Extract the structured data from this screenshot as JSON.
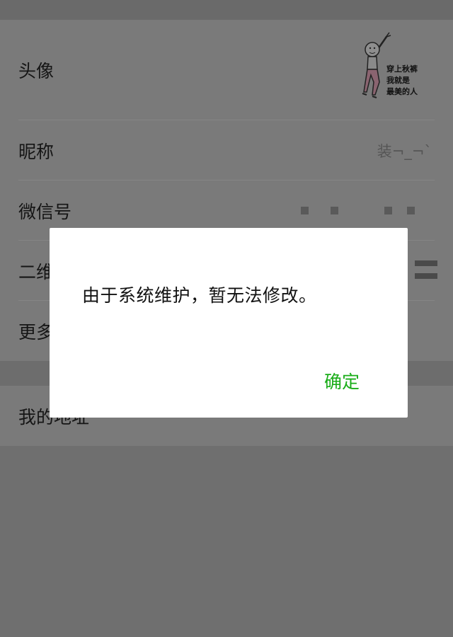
{
  "profile": {
    "avatar": {
      "label": "头像",
      "caption_lines": [
        "穿上秋裤",
        "我就是",
        "最美的人"
      ]
    },
    "nickname": {
      "label": "昵称",
      "value": "装¬_¬`"
    },
    "wechat_id": {
      "label": "微信号"
    },
    "qr_code": {
      "label": "二维码名片"
    },
    "more": {
      "label": "更多"
    },
    "address": {
      "label": "我的地址"
    }
  },
  "dialog": {
    "message": "由于系统维护，暂无法修改。",
    "ok_label": "确定"
  },
  "colors": {
    "accent_green": "#1aad19",
    "overlay_gray": "#6f6f6f"
  },
  "icons": {
    "qr": "qr-code-icon",
    "avatar_image": "avatar-meme-image"
  }
}
